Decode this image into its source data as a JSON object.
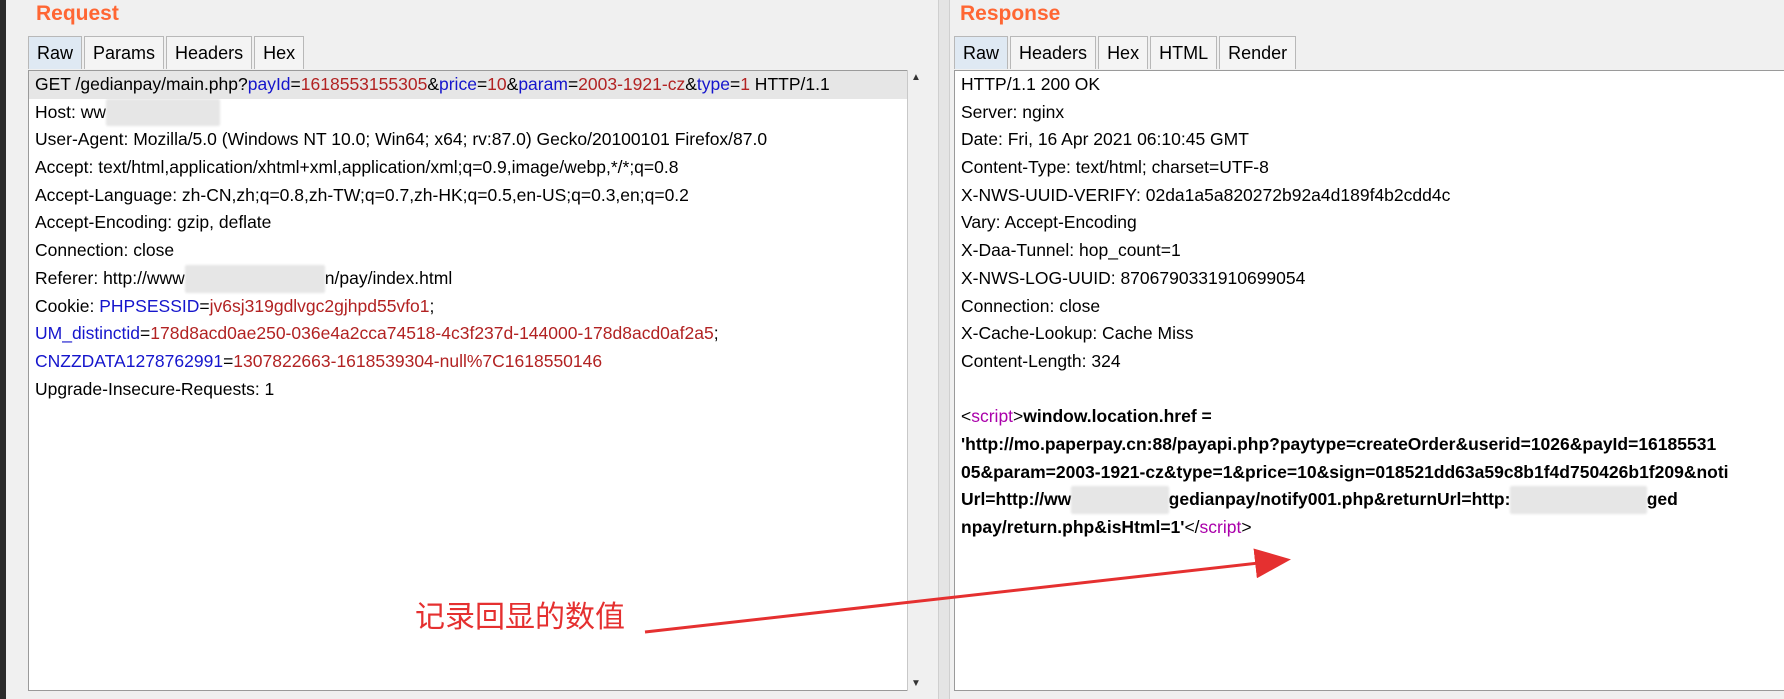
{
  "request": {
    "title": "Request",
    "tabs": [
      "Raw",
      "Params",
      "Headers",
      "Hex"
    ],
    "active_tab": "Raw",
    "lines": {
      "get_prefix": "GET /gedianpay/main.php?",
      "payId_key": "payId",
      "payId_val": "1618553155305",
      "price_key": "price",
      "price_val": "10",
      "param_key": "param",
      "param_val": "2003-1921-cz",
      "type_key": "type",
      "type_val": "1",
      "http_suffix": " HTTP/1.1",
      "host": "Host: ww",
      "user_agent": "User-Agent: Mozilla/5.0 (Windows NT 10.0; Win64; x64; rv:87.0) Gecko/20100101 Firefox/87.0",
      "accept": "Accept: text/html,application/xhtml+xml,application/xml;q=0.9,image/webp,*/*;q=0.8",
      "accept_language": "Accept-Language: zh-CN,zh;q=0.8,zh-TW;q=0.7,zh-HK;q=0.5,en-US;q=0.3,en;q=0.2",
      "accept_encoding": "Accept-Encoding: gzip, deflate",
      "connection": "Connection: close",
      "referer_prefix": "Referer: http://www",
      "referer_suffix": "n/pay/index.html",
      "cookie_prefix": "Cookie: ",
      "phpsessid_key": "PHPSESSID",
      "phpsessid_val": "jv6sj319gdlvgc2gjhpd55vfo1",
      "um_key": "UM_distinctid",
      "um_val": "178d8acd0ae250-036e4a2cca74518-4c3f237d-144000-178d8acd0af2a5",
      "cnzz_key": "CNZZDATA1278762991",
      "cnzz_val": "1307822663-1618539304-null%7C1618550146",
      "upgrade": "Upgrade-Insecure-Requests: 1"
    }
  },
  "response": {
    "title": "Response",
    "tabs": [
      "Raw",
      "Headers",
      "Hex",
      "HTML",
      "Render"
    ],
    "active_tab": "Raw",
    "lines": {
      "status": "HTTP/1.1 200 OK",
      "server": "Server: nginx",
      "date": "Date: Fri, 16 Apr 2021 06:10:45 GMT",
      "content_type": "Content-Type: text/html; charset=UTF-8",
      "uuid_verify": "X-NWS-UUID-VERIFY: 02da1a5a820272b92a4d189f4b2cdd4c",
      "vary": "Vary: Accept-Encoding",
      "daa_tunnel": "X-Daa-Tunnel: hop_count=1",
      "log_uuid": "X-NWS-LOG-UUID: 8706790331910699054",
      "connection": "Connection: close",
      "cache_lookup": "X-Cache-Lookup: Cache Miss",
      "content_length": "Content-Length: 324",
      "script_open_lt": "<",
      "script_tag": "script",
      "script_open_gt": ">",
      "script_code": "window.location.href =",
      "body_line2": "'http://mo.paperpay.cn:88/payapi.php?paytype=createOrder&userid=1026&payId=16185531",
      "body_line3": "05&param=2003-1921-cz&type=1&price=10&sign=018521dd63a59c8b1f4d750426b1f209&noti",
      "body_line4_a": "Url=http://ww",
      "body_line4_b": "gedianpay/notify001.php&returnUrl=http:",
      "body_line4_c": "ged",
      "body_line5_a": "npay/return.php&isHtml=1'",
      "script_close_lt": "</",
      "script_close_tag": "script",
      "script_close_gt": ">"
    }
  },
  "annotation": {
    "text": "记录回显的数值",
    "color": "#e53030"
  }
}
